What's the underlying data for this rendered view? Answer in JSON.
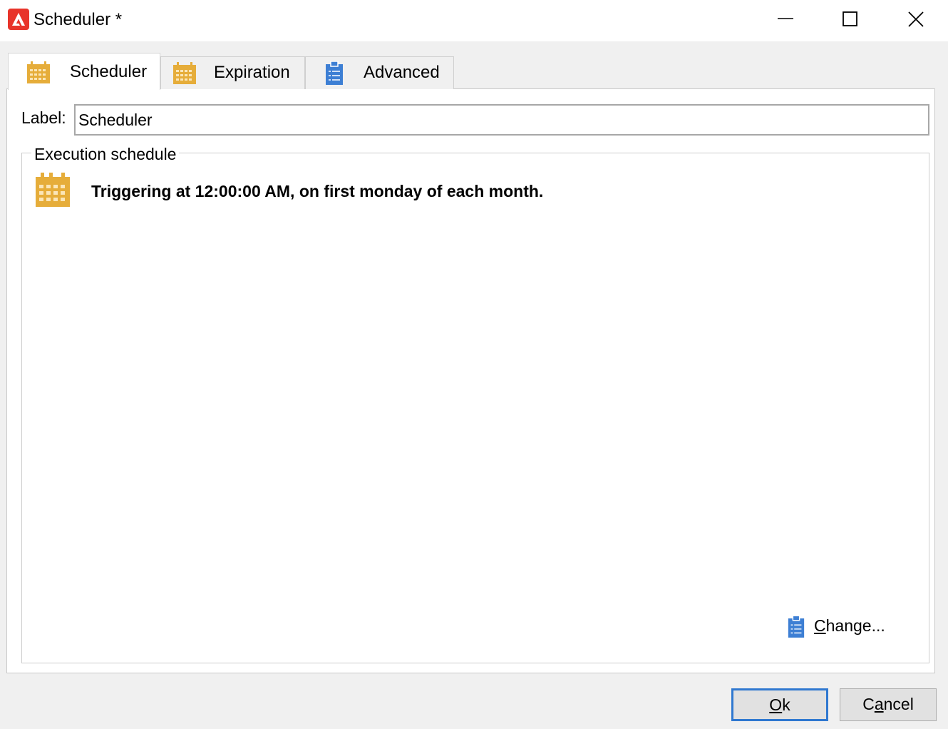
{
  "window": {
    "title": "Scheduler *",
    "app_icon": "adobe-campaign-icon",
    "controls": [
      "minimize-icon",
      "maximize-icon",
      "close-icon"
    ]
  },
  "tabs": [
    {
      "label": "Scheduler",
      "icon": "calendar-icon",
      "active": true
    },
    {
      "label": "Expiration",
      "icon": "calendar-icon",
      "active": false
    },
    {
      "label": "Advanced",
      "icon": "clipboard-icon",
      "active": false
    }
  ],
  "label_field": {
    "label": "Label:",
    "value": "Scheduler"
  },
  "execution_schedule": {
    "group_title": "Execution schedule",
    "description": "Triggering at 12:00:00 AM, on first monday of each month.",
    "change_link": {
      "accel": "C",
      "rest": "hange..."
    }
  },
  "buttons": {
    "ok": {
      "accel": "O",
      "rest": "k"
    },
    "cancel": {
      "before": "C",
      "accel": "a",
      "rest": "ncel"
    }
  },
  "colors": {
    "accent": "#2f78d0",
    "calendar": "#e6ad3a",
    "app_icon": "#e8342a",
    "clipboard": "#3d7fd4"
  }
}
